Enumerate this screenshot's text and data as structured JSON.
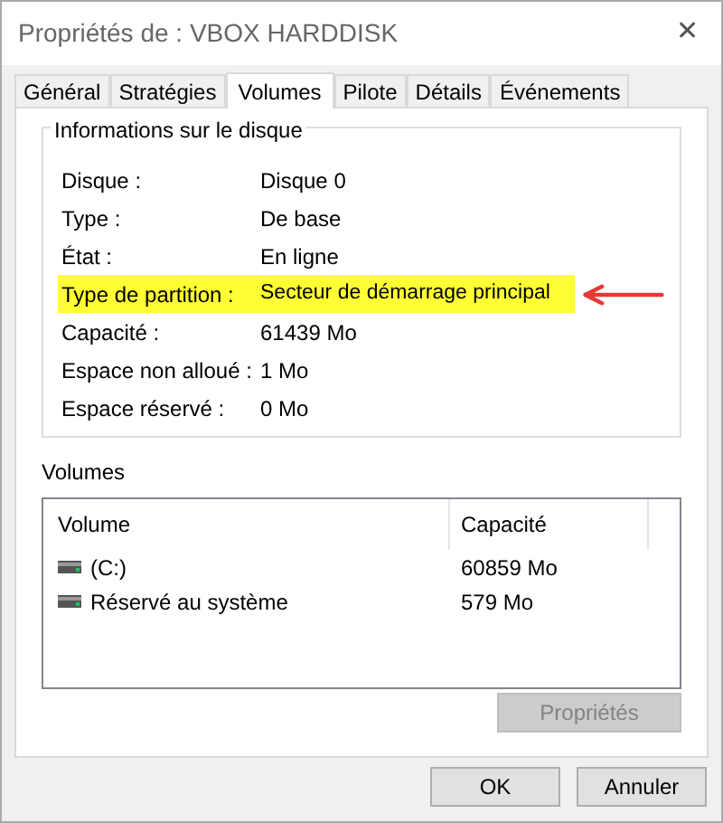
{
  "window": {
    "title": "Propriétés de : VBOX HARDDISK",
    "close": "✕"
  },
  "tabs": [
    {
      "label": "Général",
      "selected": false
    },
    {
      "label": "Stratégies",
      "selected": false
    },
    {
      "label": "Volumes",
      "selected": true
    },
    {
      "label": "Pilote",
      "selected": false
    },
    {
      "label": "Détails",
      "selected": false
    },
    {
      "label": "Événements",
      "selected": false
    }
  ],
  "disk_info": {
    "title": "Informations sur le disque",
    "rows": [
      {
        "label": "Disque :",
        "value": "Disque 0",
        "highlighted": false
      },
      {
        "label": "Type :",
        "value": "De base",
        "highlighted": false
      },
      {
        "label": "État :",
        "value": "En ligne",
        "highlighted": false
      },
      {
        "label": "Type de partition :",
        "value": "Secteur de démarrage principal",
        "highlighted": true
      },
      {
        "label": "Capacité :",
        "value": "61439 Mo",
        "highlighted": false
      },
      {
        "label": "Espace non alloué :",
        "value": "1 Mo",
        "highlighted": false
      },
      {
        "label": "Espace réservé :",
        "value": "0 Mo",
        "highlighted": false
      }
    ]
  },
  "volumes": {
    "title": "Volumes",
    "columns": [
      "Volume",
      "Capacité"
    ],
    "rows": [
      {
        "volume": "(C:)",
        "capacity": "60859 Mo"
      },
      {
        "volume": "Réservé au système",
        "capacity": "579 Mo"
      }
    ],
    "properties_button": {
      "label": "Propriétés",
      "disabled": true
    }
  },
  "buttons": [
    "OK",
    "Annuler"
  ]
}
